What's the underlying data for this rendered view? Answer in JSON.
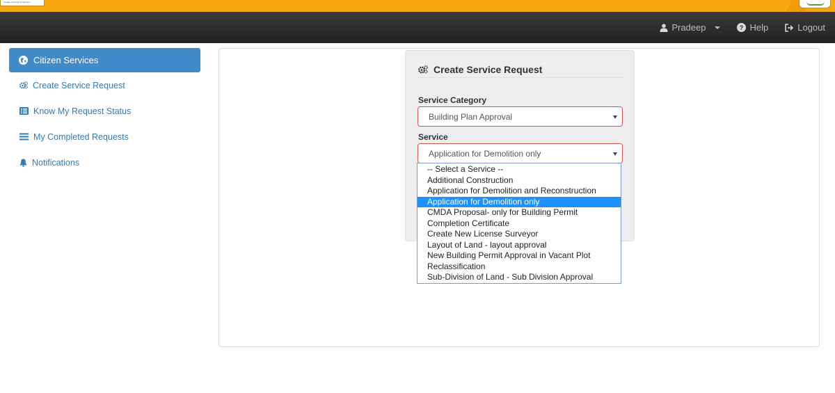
{
  "header": {
    "logo_left_text": "Greater Chennai Corporation"
  },
  "navbar": {
    "user_label": "Pradeep",
    "help_label": "Help",
    "logout_label": "Logout"
  },
  "sidebar": {
    "active": {
      "label": "Citizen Services",
      "icon": "globe-icon"
    },
    "items": [
      {
        "label": "Create Service Request",
        "icon": "cogs-icon"
      },
      {
        "label": "Know My Request Status",
        "icon": "list-alt-icon"
      },
      {
        "label": "My Completed Requests",
        "icon": "list-icon"
      },
      {
        "label": "Notifications",
        "icon": "bell-icon"
      }
    ]
  },
  "form": {
    "title": "Create Service Request",
    "category_label": "Service Category",
    "category_value": "Building Plan Approval",
    "service_label": "Service",
    "service_value": "Application for Demolition only"
  },
  "dropdown": {
    "options": [
      "-- Select a Service --",
      "Additional Construction",
      "Application for Demolition and Reconstruction",
      "Application for Demolition only",
      "CMDA Proposal- only for Building Permit",
      "Completion Certificate",
      "Create New License Surveyor",
      "Layout of Land - layout approval",
      "New Building Permit Approval in Vacant Plot",
      "Reclassification",
      "Sub-Division of Land - Sub Division Approval"
    ],
    "selected_index": 3
  },
  "colors": {
    "brand_orange": "#f7a70f",
    "navbar_dark": "#2b2b2b",
    "active_blue": "#428bca",
    "link_blue": "#337ab7",
    "error_red": "#d9534f",
    "highlight_blue": "#1e90ff"
  }
}
